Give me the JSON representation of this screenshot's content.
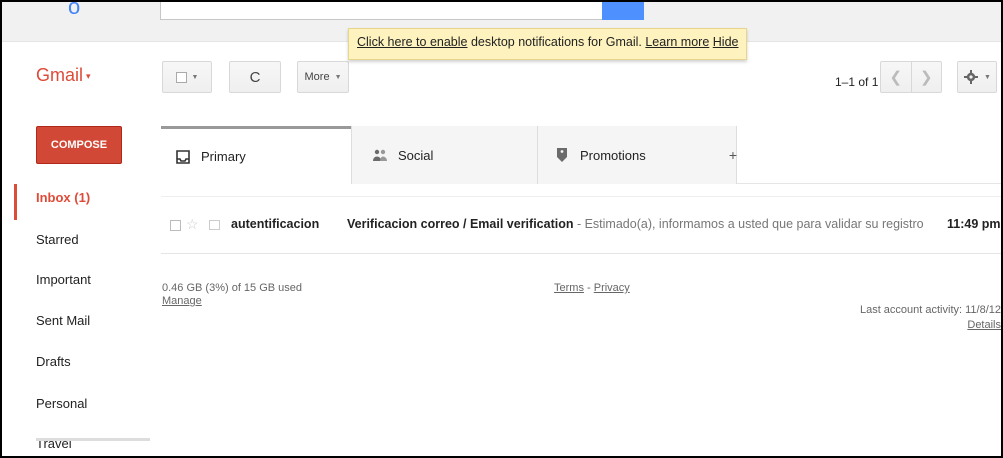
{
  "window": {
    "logo_fragment": "o"
  },
  "notification": {
    "enable_link": "Click here to enable",
    "text": " desktop notifications for Gmail.  ",
    "learn_more": "Learn more",
    "hide": "Hide"
  },
  "header": {
    "app_label": "Gmail",
    "app_caret": "▾",
    "more_label": "More",
    "refresh_icon": "C",
    "pager": "1–1 of 1",
    "prev_icon": "❮",
    "next_icon": "❯",
    "settings_icon": "gear-icon"
  },
  "sidebar": {
    "compose_label": "COMPOSE",
    "items": [
      {
        "label": "Inbox (1)",
        "active": true
      },
      {
        "label": "Starred"
      },
      {
        "label": "Important"
      },
      {
        "label": "Sent Mail"
      },
      {
        "label": "Drafts"
      },
      {
        "label": "Personal"
      },
      {
        "label": "Travel"
      }
    ]
  },
  "tabs": [
    {
      "label": "Primary",
      "icon": "inbox-icon"
    },
    {
      "label": "Social",
      "icon": "people-icon"
    },
    {
      "label": "Promotions",
      "icon": "tag-icon"
    },
    {
      "label": "+",
      "icon": "add-tab"
    }
  ],
  "messages": [
    {
      "sender": "autentificacion",
      "subject": "Verificacion correo / Email verification",
      "snippet": " - Estimado(a), informamos a usted que para validar su registro en el Sistema de Autentif",
      "time": "11:49 pm"
    }
  ],
  "footer": {
    "quota": "0.46 GB (3%) of 15 GB used",
    "manage": "Manage",
    "terms": "Terms",
    "separator": " - ",
    "privacy": "Privacy",
    "last_activity": "Last account activity: 11/8/12",
    "details": "Details"
  },
  "colors": {
    "brand_red": "#dd4b39",
    "compose_red": "#d14836",
    "notification_bg": "#fef3bf"
  }
}
